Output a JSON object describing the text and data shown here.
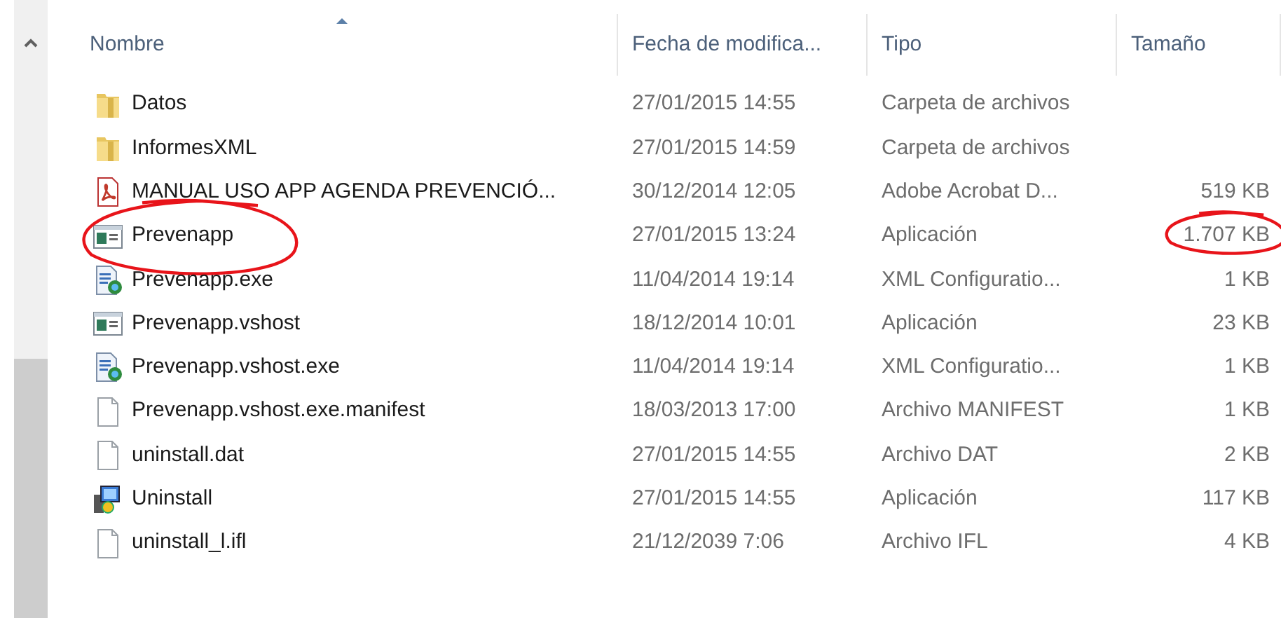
{
  "columns": [
    {
      "label": "Nombre",
      "sorted": true
    },
    {
      "label": "Fecha de modifica..."
    },
    {
      "label": "Tipo"
    },
    {
      "label": "Tamaño"
    }
  ],
  "rows": [
    {
      "kind": "folder",
      "name": "Datos",
      "date": "27/01/2015 14:55",
      "type": "Carpeta de archivos",
      "circled_name": false,
      "circled_size": false
    },
    {
      "kind": "folder",
      "name": "InformesXML",
      "date": "27/01/2015 14:59",
      "type": "Carpeta de archivos",
      "circled_name": false,
      "circled_size": false
    },
    {
      "kind": "pdf",
      "name": "MANUAL USO APP AGENDA PREVENCIÓ...",
      "date": "30/12/2014 12:05",
      "type": "Adobe Acrobat D...",
      "size": "519 KB",
      "circled_name": false,
      "circled_size": false
    },
    {
      "kind": "app",
      "name": "Prevenapp",
      "date": "27/01/2015 13:24",
      "type": "Aplicación",
      "size": "1.707 KB",
      "circled_name": true,
      "circled_size": true
    },
    {
      "kind": "config",
      "name": "Prevenapp.exe",
      "date": "11/04/2014 19:14",
      "type": "XML Configuratio...",
      "size": "1 KB",
      "circled_name": false,
      "circled_size": false
    },
    {
      "kind": "app",
      "name": "Prevenapp.vshost",
      "date": "18/12/2014 10:01",
      "type": "Aplicación",
      "size": "23 KB",
      "circled_name": false,
      "circled_size": false
    },
    {
      "kind": "config",
      "name": "Prevenapp.vshost.exe",
      "date": "11/04/2014 19:14",
      "type": "XML Configuratio...",
      "size": "1 KB",
      "circled_name": false,
      "circled_size": false
    },
    {
      "kind": "file",
      "name": "Prevenapp.vshost.exe.manifest",
      "date": "18/03/2013 17:00",
      "type": "Archivo MANIFEST",
      "size": "1 KB",
      "circled_name": false,
      "circled_size": false
    },
    {
      "kind": "file",
      "name": "uninstall.dat",
      "date": "27/01/2015 14:55",
      "type": "Archivo DAT",
      "size": "2 KB",
      "circled_name": false,
      "circled_size": false
    },
    {
      "kind": "installer",
      "name": "Uninstall",
      "date": "27/01/2015 14:55",
      "type": "Aplicación",
      "size": "117 KB",
      "circled_name": false,
      "circled_size": false
    },
    {
      "kind": "file",
      "name": "uninstall_l.ifl",
      "date": "21/12/2039 7:06",
      "type": "Archivo IFL",
      "size": "4 KB",
      "circled_name": false,
      "circled_size": false
    }
  ]
}
